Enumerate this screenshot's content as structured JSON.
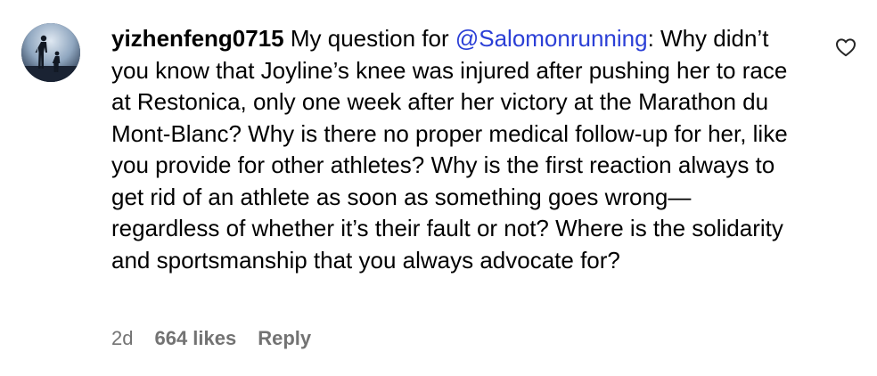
{
  "comment": {
    "username": "yizhenfeng0715",
    "text_before_mention": " My question for ",
    "mention": "@Salomonrunning",
    "text_after_mention": ": Why didn’t you know that Joyline’s knee was injured after pushing her to race at Restonica, only one week after her victory at the Marathon du Mont-Blanc? Why is there no proper medical follow-up for her, like you provide for other athletes? Why is the first reaction always to get rid of an athlete as soon as something goes wrong—regardless of whether it’s their fault or not? Where is the solidarity and sportsmanship that you always advocate for?",
    "timestamp": "2d",
    "likes": "664 likes",
    "reply_label": "Reply"
  },
  "icons": {
    "like": "heart-outline-icon",
    "avatar": "runner-silhouette-avatar"
  },
  "colors": {
    "mention": "#2b3fd6",
    "meta_text": "#737373"
  }
}
